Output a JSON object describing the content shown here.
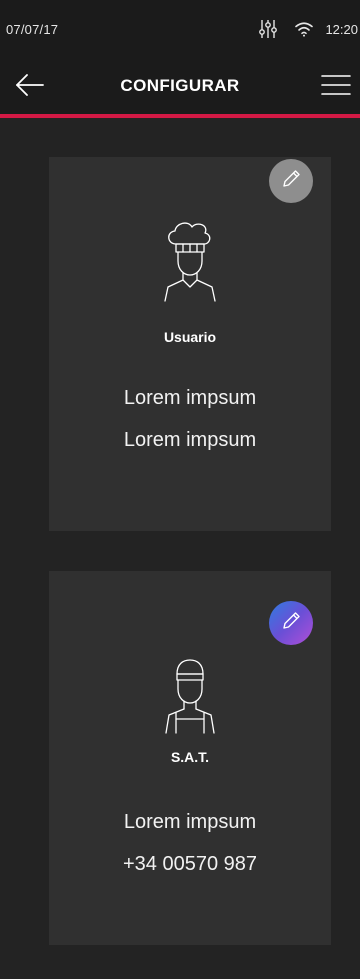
{
  "status_bar": {
    "date": "07/07/17",
    "time": "12:20",
    "icons": [
      "equalizer-icon",
      "wifi-icon"
    ]
  },
  "app_bar": {
    "title": "CONFIGURAR",
    "back_icon": "arrow-left-icon",
    "menu_icon": "hamburger-menu-icon",
    "accent_color": "#d41945"
  },
  "cards": [
    {
      "role": "Usuario",
      "icon": "chef-icon",
      "edit_icon": "pencil-icon",
      "edit_color": "#8e8e8e",
      "line1": "Lorem impsum",
      "line2": "Lorem impsum"
    },
    {
      "role": "S.A.T.",
      "icon": "technician-icon",
      "edit_icon": "pencil-icon",
      "edit_color": "#6a4fd6",
      "line1": "Lorem impsum",
      "line2": "+34 00570 987"
    }
  ]
}
